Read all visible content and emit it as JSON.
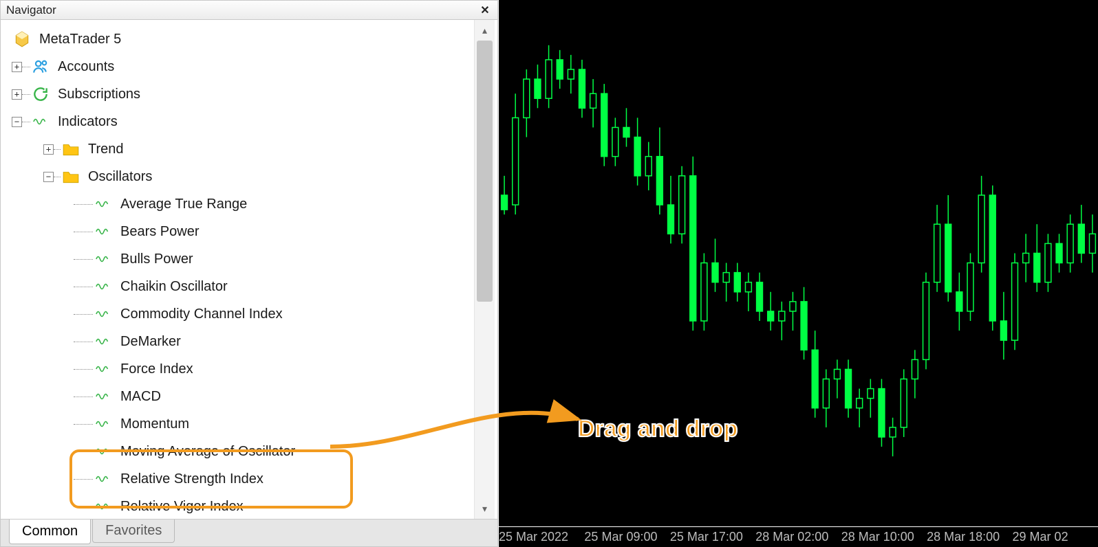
{
  "navigator": {
    "title": "Navigator",
    "root": "MetaTrader 5",
    "accounts": "Accounts",
    "subscriptions": "Subscriptions",
    "indicators": "Indicators",
    "folders": {
      "trend": "Trend",
      "oscillators": "Oscillators"
    },
    "oscillator_items": [
      "Average True Range",
      "Bears Power",
      "Bulls Power",
      "Chaikin Oscillator",
      "Commodity Channel Index",
      "DeMarker",
      "Force Index",
      "MACD",
      "Momentum",
      "Moving Average of Oscillator",
      "Relative Strength Index",
      "Relative Vigor Index"
    ],
    "highlighted_index": 10,
    "tabs": {
      "common": "Common",
      "favorites": "Favorites"
    }
  },
  "chart": {
    "time_labels": [
      "25 Mar 2022",
      "25 Mar 09:00",
      "25 Mar 17:00",
      "28 Mar 02:00",
      "28 Mar 10:00",
      "28 Mar 18:00",
      "29 Mar 02"
    ]
  },
  "chart_data": {
    "type": "candlestick",
    "timeframe": "H1",
    "note": "pixel-estimated OHLC; y = approximate price level in relative units (0 bottom, 100 top)",
    "candles": [
      {
        "o": 64,
        "h": 68,
        "l": 60,
        "c": 61
      },
      {
        "o": 62,
        "h": 85,
        "l": 60,
        "c": 80
      },
      {
        "o": 80,
        "h": 90,
        "l": 76,
        "c": 88
      },
      {
        "o": 88,
        "h": 91,
        "l": 82,
        "c": 84
      },
      {
        "o": 84,
        "h": 95,
        "l": 82,
        "c": 92
      },
      {
        "o": 92,
        "h": 94,
        "l": 86,
        "c": 88
      },
      {
        "o": 88,
        "h": 93,
        "l": 85,
        "c": 90
      },
      {
        "o": 90,
        "h": 92,
        "l": 80,
        "c": 82
      },
      {
        "o": 82,
        "h": 88,
        "l": 78,
        "c": 85
      },
      {
        "o": 85,
        "h": 87,
        "l": 70,
        "c": 72
      },
      {
        "o": 72,
        "h": 80,
        "l": 70,
        "c": 78
      },
      {
        "o": 78,
        "h": 82,
        "l": 74,
        "c": 76
      },
      {
        "o": 76,
        "h": 80,
        "l": 66,
        "c": 68
      },
      {
        "o": 68,
        "h": 75,
        "l": 65,
        "c": 72
      },
      {
        "o": 72,
        "h": 78,
        "l": 60,
        "c": 62
      },
      {
        "o": 62,
        "h": 68,
        "l": 54,
        "c": 56
      },
      {
        "o": 56,
        "h": 70,
        "l": 54,
        "c": 68
      },
      {
        "o": 68,
        "h": 72,
        "l": 36,
        "c": 38
      },
      {
        "o": 38,
        "h": 52,
        "l": 36,
        "c": 50
      },
      {
        "o": 50,
        "h": 55,
        "l": 44,
        "c": 46
      },
      {
        "o": 46,
        "h": 50,
        "l": 42,
        "c": 48
      },
      {
        "o": 48,
        "h": 50,
        "l": 42,
        "c": 44
      },
      {
        "o": 44,
        "h": 48,
        "l": 40,
        "c": 46
      },
      {
        "o": 46,
        "h": 48,
        "l": 38,
        "c": 40
      },
      {
        "o": 40,
        "h": 44,
        "l": 36,
        "c": 38
      },
      {
        "o": 38,
        "h": 42,
        "l": 34,
        "c": 40
      },
      {
        "o": 40,
        "h": 44,
        "l": 36,
        "c": 42
      },
      {
        "o": 42,
        "h": 45,
        "l": 30,
        "c": 32
      },
      {
        "o": 32,
        "h": 36,
        "l": 18,
        "c": 20
      },
      {
        "o": 20,
        "h": 28,
        "l": 16,
        "c": 26
      },
      {
        "o": 26,
        "h": 30,
        "l": 22,
        "c": 28
      },
      {
        "o": 28,
        "h": 30,
        "l": 18,
        "c": 20
      },
      {
        "o": 20,
        "h": 24,
        "l": 16,
        "c": 22
      },
      {
        "o": 22,
        "h": 26,
        "l": 18,
        "c": 24
      },
      {
        "o": 24,
        "h": 26,
        "l": 12,
        "c": 14
      },
      {
        "o": 14,
        "h": 18,
        "l": 10,
        "c": 16
      },
      {
        "o": 16,
        "h": 28,
        "l": 14,
        "c": 26
      },
      {
        "o": 26,
        "h": 32,
        "l": 22,
        "c": 30
      },
      {
        "o": 30,
        "h": 48,
        "l": 28,
        "c": 46
      },
      {
        "o": 46,
        "h": 62,
        "l": 44,
        "c": 58
      },
      {
        "o": 58,
        "h": 64,
        "l": 42,
        "c": 44
      },
      {
        "o": 44,
        "h": 48,
        "l": 36,
        "c": 40
      },
      {
        "o": 40,
        "h": 52,
        "l": 38,
        "c": 50
      },
      {
        "o": 50,
        "h": 68,
        "l": 48,
        "c": 64
      },
      {
        "o": 64,
        "h": 66,
        "l": 36,
        "c": 38
      },
      {
        "o": 38,
        "h": 44,
        "l": 30,
        "c": 34
      },
      {
        "o": 34,
        "h": 52,
        "l": 32,
        "c": 50
      },
      {
        "o": 50,
        "h": 56,
        "l": 46,
        "c": 52
      },
      {
        "o": 52,
        "h": 58,
        "l": 44,
        "c": 46
      },
      {
        "o": 46,
        "h": 56,
        "l": 44,
        "c": 54
      },
      {
        "o": 54,
        "h": 56,
        "l": 48,
        "c": 50
      },
      {
        "o": 50,
        "h": 60,
        "l": 48,
        "c": 58
      },
      {
        "o": 58,
        "h": 62,
        "l": 50,
        "c": 52
      },
      {
        "o": 52,
        "h": 60,
        "l": 48,
        "c": 56
      }
    ]
  },
  "annotation": {
    "text": "Drag and drop"
  }
}
